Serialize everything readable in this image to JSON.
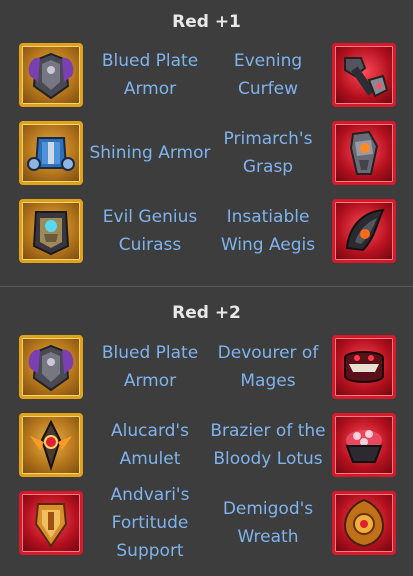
{
  "sections": [
    {
      "title": "Red +1",
      "rows": [
        {
          "left_name": "Blued Plate Armor",
          "left_icon": "blued-plate-armor-icon",
          "right_name": "Evening Curfew",
          "right_icon": "evening-curfew-icon"
        },
        {
          "left_name": "Shining Armor",
          "left_icon": "shining-armor-icon",
          "right_name": "Primarch's Grasp",
          "right_icon": "primarchs-grasp-icon"
        },
        {
          "left_name": "Evil Genius Cuirass",
          "left_icon": "evil-genius-cuirass-icon",
          "right_name": "Insatiable Wing Aegis",
          "right_icon": "insatiable-wing-aegis-icon"
        }
      ]
    },
    {
      "title": "Red +2",
      "rows": [
        {
          "left_name": "Blued Plate Armor",
          "left_icon": "blued-plate-armor-icon",
          "right_name": "Devourer of Mages",
          "right_icon": "devourer-of-mages-icon"
        },
        {
          "left_name": "Alucard's Amulet",
          "left_icon": "alucards-amulet-icon",
          "right_name": "Brazier of the Bloody Lotus",
          "right_icon": "brazier-of-the-bloody-lotus-icon"
        },
        {
          "left_name": "Andvari's Fortitude Support",
          "left_icon": "andvaris-fortitude-support-icon",
          "right_name": "Demigod's Wreath",
          "right_icon": "demigods-wreath-icon"
        }
      ]
    }
  ],
  "colors": {
    "background": "#3d3d3d",
    "title": "#e8e8e8",
    "item_name": "#7fb3ee",
    "gold_frame": "#e0a21c",
    "red_frame": "#d8192a"
  }
}
